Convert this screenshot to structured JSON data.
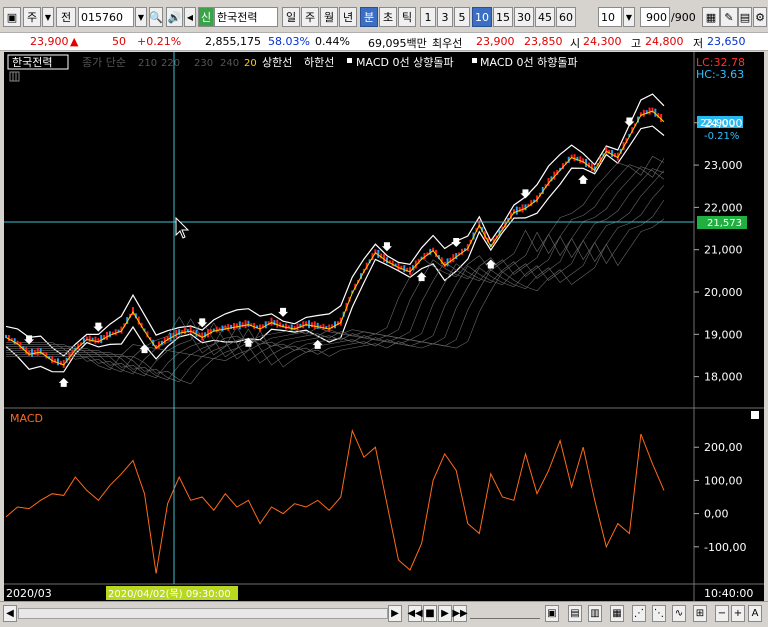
{
  "toolbar": {
    "market_label": "주",
    "type_label": "전",
    "code_value": "015760",
    "new_badge": "신",
    "name_value": "한국전력",
    "periods": [
      "일",
      "주",
      "월",
      "년",
      "분",
      "초",
      "틱"
    ],
    "selected_period": "분",
    "intervals": [
      "1",
      "3",
      "5",
      "10",
      "15",
      "30",
      "45",
      "60"
    ],
    "selected_interval": "10",
    "interval_input": "10",
    "count_value": "900",
    "count_total": "/900"
  },
  "quote": {
    "price": "23,900",
    "change": "50",
    "change_pct": "+0.21%",
    "volume": "2,855,175",
    "volume_ratio": "58.03%",
    "turnover_ratio": "0.44%",
    "amount": "69,095백만",
    "best_ask_label": "최우선",
    "best_ask": "23,900",
    "best_bid": "23,850",
    "open_label": "시",
    "open": "24,300",
    "high_label": "고",
    "high": "24,800",
    "low_label": "저",
    "low": "23,650"
  },
  "legend": {
    "name": "한국전력",
    "ma_label": "종가 단순",
    "ma_periods": [
      "210",
      "220",
      "230",
      "240",
      "20"
    ],
    "upper": "상한선",
    "lower": "하한선",
    "macd_up": "MACD 0선 상향돌파",
    "macd_down": "MACD 0선 하향돌파"
  },
  "right_labels": {
    "lc": "LC:32.78",
    "hc": "HC:-3.63",
    "price_tag": "23,900",
    "pct_tag": "-0.21%",
    "cross_tag": "21,573"
  },
  "macd_title": "MACD",
  "time_labels": {
    "start": "2020/03",
    "cursor": "2020/04/02(목) 09:30:00",
    "end": "10:40:00"
  },
  "colors": {
    "up": "#ff2020",
    "down": "#20a0ff",
    "band": "#ffffff",
    "ma": "#ffd000",
    "macd": "#ff6a1a",
    "crosshair": "#40c0d0"
  },
  "chart_data": [
    {
      "type": "line",
      "title": "한국전력",
      "yticks": [
        "18,000",
        "19,000",
        "20,000",
        "21,000",
        "22,000",
        "23,000",
        "24,000"
      ],
      "ylim": [
        17400,
        25200
      ],
      "note": "Candlestick price chart with Bollinger-like bands",
      "series": [
        {
          "name": "price",
          "values": [
            18950,
            18800,
            18550,
            18600,
            18400,
            18300,
            18650,
            18900,
            18850,
            19000,
            19100,
            19550,
            19100,
            18700,
            18900,
            19050,
            19100,
            18950,
            19100,
            19150,
            19200,
            19250,
            19150,
            19300,
            19200,
            19150,
            19250,
            19200,
            19150,
            19300,
            20000,
            20500,
            20950,
            20750,
            20600,
            20500,
            20800,
            21000,
            20650,
            20850,
            21050,
            21600,
            21100,
            21500,
            21900,
            22000,
            22200,
            22600,
            22900,
            23200,
            23100,
            22900,
            23350,
            23200,
            23700,
            24200,
            24300,
            24050
          ]
        }
      ]
    },
    {
      "type": "line",
      "title": "MACD",
      "yticks": [
        "200,00",
        "100,00",
        "0,00",
        "-100,00"
      ],
      "ylim": [
        -200,
        270
      ],
      "series": [
        {
          "name": "MACD",
          "values": [
            -10,
            20,
            15,
            40,
            60,
            55,
            110,
            70,
            40,
            85,
            120,
            160,
            60,
            -180,
            30,
            110,
            40,
            50,
            10,
            60,
            20,
            40,
            -30,
            20,
            0,
            30,
            20,
            40,
            10,
            50,
            250,
            170,
            200,
            30,
            -140,
            -170,
            -90,
            100,
            180,
            130,
            -30,
            -60,
            120,
            50,
            40,
            180,
            60,
            130,
            220,
            80,
            200,
            40,
            -100,
            -30,
            -60,
            240,
            150,
            70
          ]
        }
      ]
    }
  ]
}
